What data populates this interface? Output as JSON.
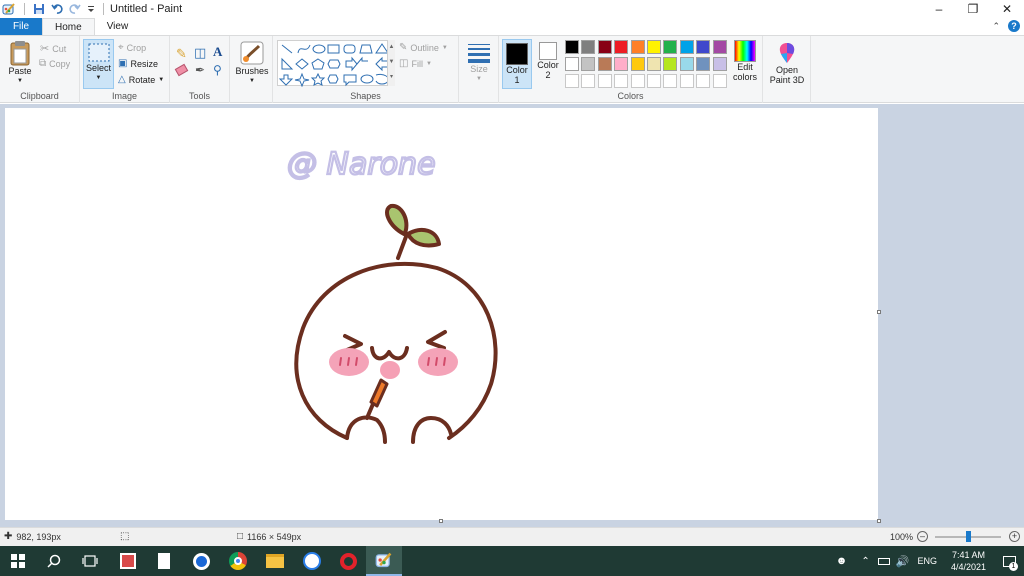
{
  "window": {
    "title": "Untitled - Paint",
    "minimize_icon": "minimize-icon",
    "restore_icon": "restore-icon",
    "close_icon": "close-icon"
  },
  "tabs": {
    "file": "File",
    "home": "Home",
    "view": "View"
  },
  "ribbon": {
    "clipboard": {
      "label": "Clipboard",
      "paste": "Paste",
      "cut": "Cut",
      "copy": "Copy"
    },
    "image": {
      "label": "Image",
      "select": "Select",
      "crop": "Crop",
      "resize": "Resize",
      "rotate": "Rotate"
    },
    "tools": {
      "label": "Tools"
    },
    "brushes": {
      "label": "Brushes"
    },
    "shapes": {
      "label": "Shapes",
      "outline": "Outline",
      "fill": "Fill"
    },
    "size": {
      "label": "Size"
    },
    "colors": {
      "label": "Colors",
      "color1": "Color 1",
      "color2": "Color 2",
      "edit_colors": "Edit colors",
      "color1_value": "#000000",
      "color2_value": "#ffffff",
      "palette_row1": [
        "#000000",
        "#7f7f7f",
        "#880015",
        "#ed1c24",
        "#ff7f27",
        "#fff200",
        "#22b14c",
        "#00a2e8",
        "#3f48cc",
        "#a349a4"
      ],
      "palette_row2": [
        "#ffffff",
        "#c3c3c3",
        "#b97a57",
        "#ffaec9",
        "#ffc90e",
        "#efe4b0",
        "#b5e61d",
        "#99d9ea",
        "#7092be",
        "#c8bfe7"
      ]
    },
    "paint3d": {
      "label": "Open Paint 3D"
    }
  },
  "canvas": {
    "watermark": "@ Narone",
    "watermark_color": "#c4bfe6",
    "outline_color": "#6b2e1f",
    "blush_color": "#f4a3b8",
    "leaf_color": "#a9c46f",
    "tongue_color": "#f5a0b5",
    "carrot_color": "#ee7a2a"
  },
  "status": {
    "cursor": "982, 193px",
    "canvas_size": "1166 × 549px",
    "zoom": "100%",
    "zoom_level": 0.5
  },
  "taskbar": {
    "lang": "ENG",
    "time": "7:41 AM",
    "date": "4/4/2021",
    "notification_count": "1"
  }
}
